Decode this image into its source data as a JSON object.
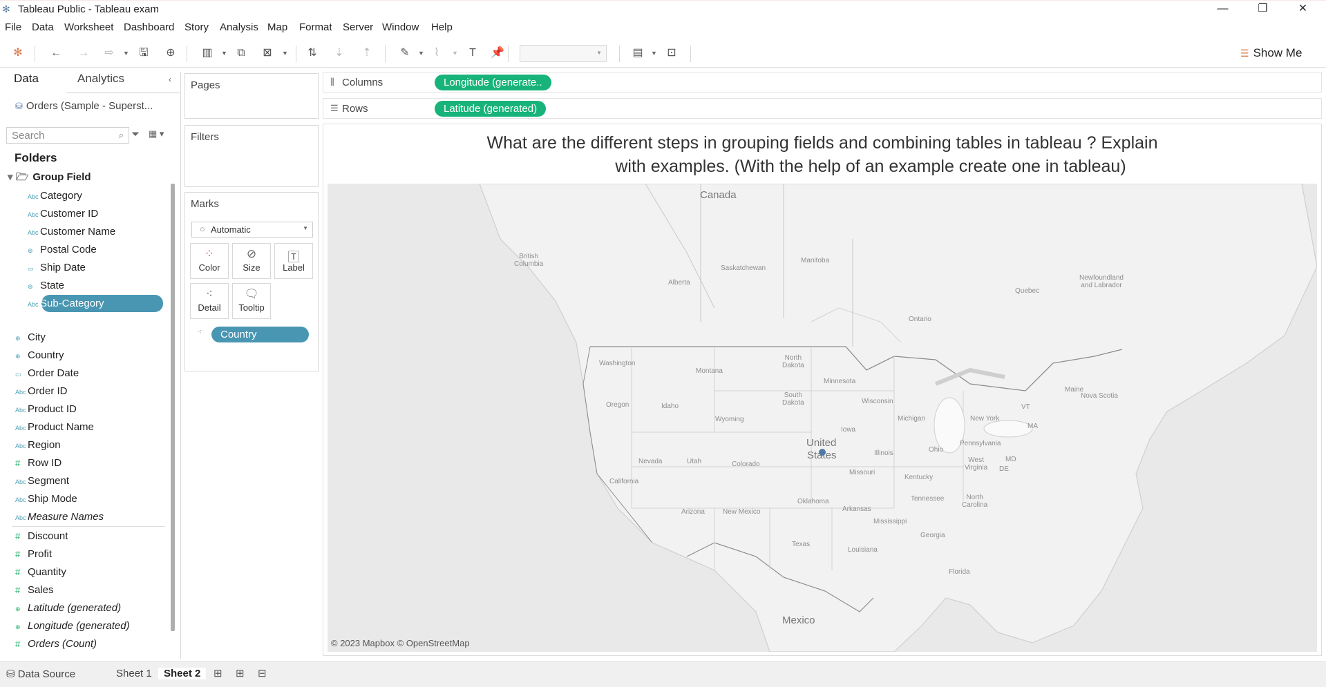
{
  "window": {
    "title": "Tableau Public - Tableau exam"
  },
  "menu": [
    "File",
    "Data",
    "Worksheet",
    "Dashboard",
    "Story",
    "Analysis",
    "Map",
    "Format",
    "Server",
    "Window",
    "Help"
  ],
  "toolbar": {
    "show_me": "Show Me"
  },
  "data_pane": {
    "tabs": [
      "Data",
      "Analytics"
    ],
    "datasource": "Orders (Sample - Superst...",
    "search_placeholder": "Search",
    "folders_title": "Folders",
    "group_name": "Group Field",
    "group_fields": [
      {
        "label": "Category",
        "type": "Abc"
      },
      {
        "label": "Customer ID",
        "type": "Abc"
      },
      {
        "label": "Customer Name",
        "type": "Abc"
      },
      {
        "label": "Postal Code",
        "type": "geo"
      },
      {
        "label": "Ship Date",
        "type": "date"
      },
      {
        "label": "State",
        "type": "geo"
      },
      {
        "label": "Sub-Category",
        "type": "Abc",
        "selected": true
      }
    ],
    "dimensions": [
      {
        "label": "City",
        "type": "geo"
      },
      {
        "label": "Country",
        "type": "geo"
      },
      {
        "label": "Order Date",
        "type": "date"
      },
      {
        "label": "Order ID",
        "type": "Abc"
      },
      {
        "label": "Product ID",
        "type": "Abc"
      },
      {
        "label": "Product Name",
        "type": "Abc"
      },
      {
        "label": "Region",
        "type": "Abc"
      },
      {
        "label": "Row ID",
        "type": "#"
      },
      {
        "label": "Segment",
        "type": "Abc"
      },
      {
        "label": "Ship Mode",
        "type": "Abc"
      },
      {
        "label": "Measure Names",
        "type": "Abc",
        "italic": true
      }
    ],
    "measures": [
      {
        "label": "Discount",
        "type": "#"
      },
      {
        "label": "Profit",
        "type": "#"
      },
      {
        "label": "Quantity",
        "type": "#"
      },
      {
        "label": "Sales",
        "type": "#"
      },
      {
        "label": "Latitude (generated)",
        "type": "geo",
        "italic": true
      },
      {
        "label": "Longitude (generated)",
        "type": "geo",
        "italic": true
      },
      {
        "label": "Orders (Count)",
        "type": "#",
        "italic": true
      }
    ]
  },
  "cards": {
    "pages": "Pages",
    "filters": "Filters",
    "marks": "Marks",
    "mark_type": "Automatic",
    "mark_buttons": [
      "Color",
      "Size",
      "Label",
      "Detail",
      "Tooltip"
    ],
    "detail_pill": "Country"
  },
  "shelves": {
    "columns_label": "Columns",
    "columns_pill": "Longitude (generate..",
    "rows_label": "Rows",
    "rows_pill": "Latitude (generated)"
  },
  "viz": {
    "title_line1": "What are the different steps in grouping fields and combining tables in tableau ? Explain",
    "title_line2": "with examples. (With the help of an example create one in tableau)",
    "attribution": "© 2023 Mapbox © OpenStreetMap",
    "labels": {
      "canada": "Canada",
      "mexico": "Mexico",
      "us_line1": "United",
      "us_line2": "States",
      "regions": [
        "British\nColumbia",
        "Alberta",
        "Saskatchewan",
        "Manitoba",
        "Ontario",
        "Quebec",
        "Newfoundland\nand Labrador",
        "Washington",
        "Oregon",
        "California",
        "Nevada",
        "Idaho",
        "Montana",
        "Wyoming",
        "Utah",
        "Arizona",
        "Colorado",
        "New Mexico",
        "North\nDakota",
        "South\nDakota",
        "Minnesota",
        "Iowa",
        "Wisconsin",
        "Michigan",
        "Illinois",
        "Ohio",
        "New York",
        "Pennsylvania",
        "Maine",
        "Nova Scotia",
        "VT",
        "MA",
        "MD",
        "DE",
        "West\nVirginia",
        "Kentucky",
        "Tennessee",
        "Missouri",
        "Arkansas",
        "Oklahoma",
        "Texas",
        "Louisiana",
        "Mississippi",
        "Georgia",
        "North\nCarolina",
        "Florida"
      ]
    }
  },
  "bottom_tabs": [
    "Data Source",
    "Sheet 1",
    "Sheet 2"
  ]
}
